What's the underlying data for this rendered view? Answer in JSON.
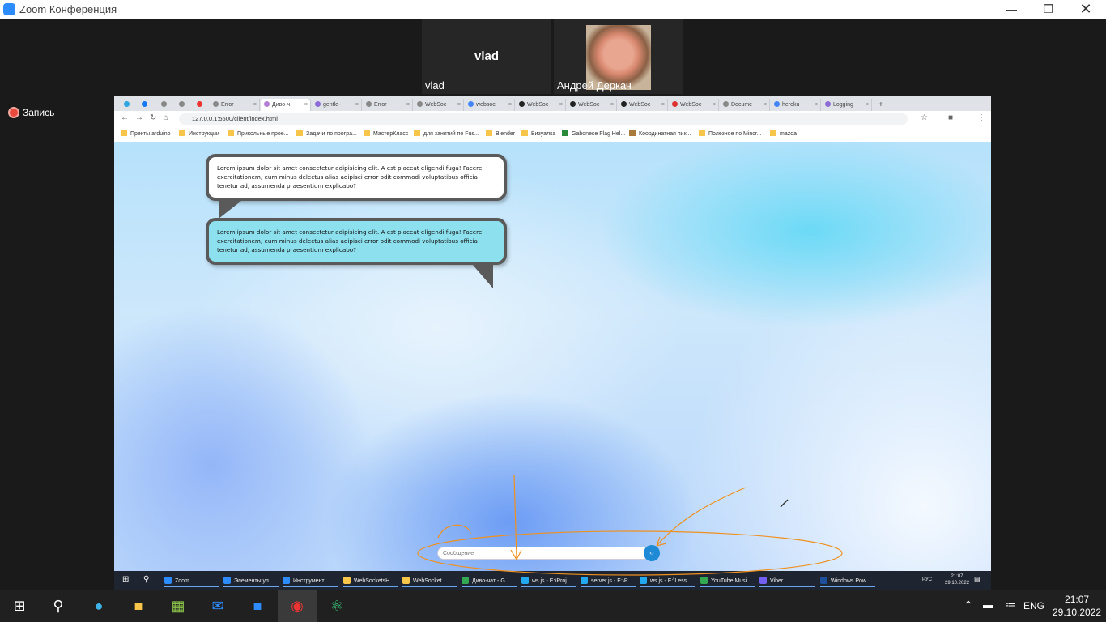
{
  "zoom": {
    "title": "Zoom Конференция",
    "recording_label": "Запись",
    "participants": [
      {
        "name": "vlad",
        "display": "vlad"
      },
      {
        "name": "Андрей Деркач"
      }
    ]
  },
  "browser": {
    "tabs": [
      "Error",
      "Диво-ч",
      "gentle-",
      "Error",
      "WebSoc",
      "websoc",
      "WebSoc",
      "WebSoc",
      "WebSoc",
      "WebSoc",
      "Docume",
      "heroku",
      "Logging"
    ],
    "url": "127.0.0.1:5500/client/index.html",
    "bookmarks": [
      "Пректы arduino",
      "Инструкции",
      "Прикольные прое...",
      "Задачи по програ...",
      "МастерКласс",
      "для занятий по Fus...",
      "Blender",
      "Визуалка",
      "Gabonese Flag Hel...",
      "Координатная пик...",
      "Полезное по Mincr...",
      "mazda"
    ]
  },
  "chat": {
    "messages": [
      "Lorem ipsum dolor sit amet consectetur adipisicing elit. A est placeat eligendi fuga! Facere exercitationem, eum minus delectus alias adipisci error odit commodi voluptatibus officia tenetur ad, assumenda praesentium explicabo?",
      "Lorem ipsum dolor sit amet consectetur adipisicing elit. A est placeat eligendi fuga! Facere exercitationem, eum minus delectus alias adipisci error odit commodi voluptatibus officia tenetur ad, assumenda praesentium explicabo?"
    ],
    "input_placeholder": "Сообщение",
    "send_icon": "send-icon"
  },
  "inner_taskbar": {
    "items": [
      "Zoom",
      "Элементы уп...",
      "Инструмент...",
      "WebSocketsH...",
      "WebSocket",
      "Диво-чат - G...",
      "ws.js - E:\\Proj...",
      "server.js - E:\\P...",
      "ws.js - E:\\Less...",
      "YouTube Musi...",
      "Viber",
      "Windows Pow..."
    ],
    "lang": "РУС",
    "time": "21:07",
    "date": "29.10.2022"
  },
  "taskbar": {
    "lang": "ENG",
    "time": "21:07",
    "date": "29.10.2022"
  },
  "colors": {
    "annotation": "#f0901e",
    "zoom_blue": "#2d8cff",
    "bubble_alt": "#8de0ee"
  }
}
